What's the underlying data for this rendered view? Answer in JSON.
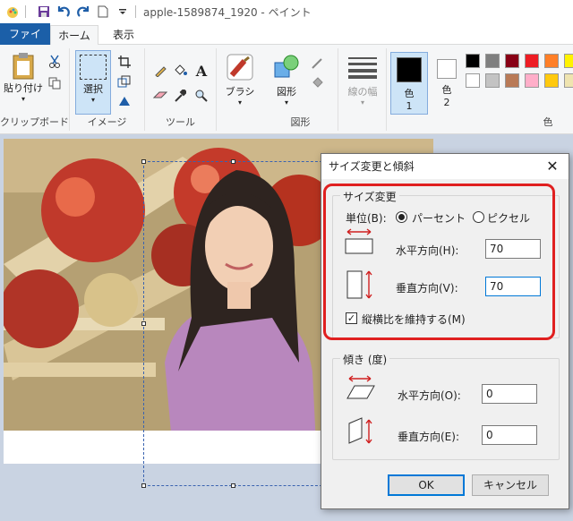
{
  "window": {
    "title": "apple-1589874_1920 - ペイント"
  },
  "tabs": [
    {
      "label": "ファイル"
    },
    {
      "label": "ホーム"
    },
    {
      "label": "表示"
    }
  ],
  "ribbon": {
    "clipboard": {
      "paste": "貼り付け",
      "group": "クリップボード"
    },
    "image": {
      "select": "選択",
      "group": "イメージ"
    },
    "tools": {
      "group": "ツール"
    },
    "brushes": {
      "label": "ブラシ"
    },
    "shapes": {
      "label": "図形",
      "group": "図形"
    },
    "size": {
      "label": "線の幅"
    },
    "color1": {
      "label": "色",
      "num": "1"
    },
    "color2": {
      "label": "色",
      "num": "2"
    },
    "colors_group": "色",
    "palette": [
      "#000000",
      "#7f7f7f",
      "#880015",
      "#ed1c24",
      "#ff7f27",
      "#fff200",
      "#ffffff",
      "#c3c3c3",
      "#b97a57",
      "#ffaec9",
      "#ffc90e",
      "#efe4b0"
    ]
  },
  "dialog": {
    "title": "サイズ変更と傾斜",
    "close": "✕",
    "resize": {
      "legend": "サイズ変更",
      "unit_label": "単位(B):",
      "percent": "パーセント",
      "pixels": "ピクセル",
      "horizontal_label": "水平方向(H):",
      "horizontal_value": "70",
      "vertical_label": "垂直方向(V):",
      "vertical_value": "70",
      "maintain": "縦横比を維持する(M)"
    },
    "skew": {
      "legend": "傾き (度)",
      "horizontal_label": "水平方向(O):",
      "horizontal_value": "0",
      "vertical_label": "垂直方向(E):",
      "vertical_value": "0"
    },
    "ok": "OK",
    "cancel": "キャンセル"
  }
}
